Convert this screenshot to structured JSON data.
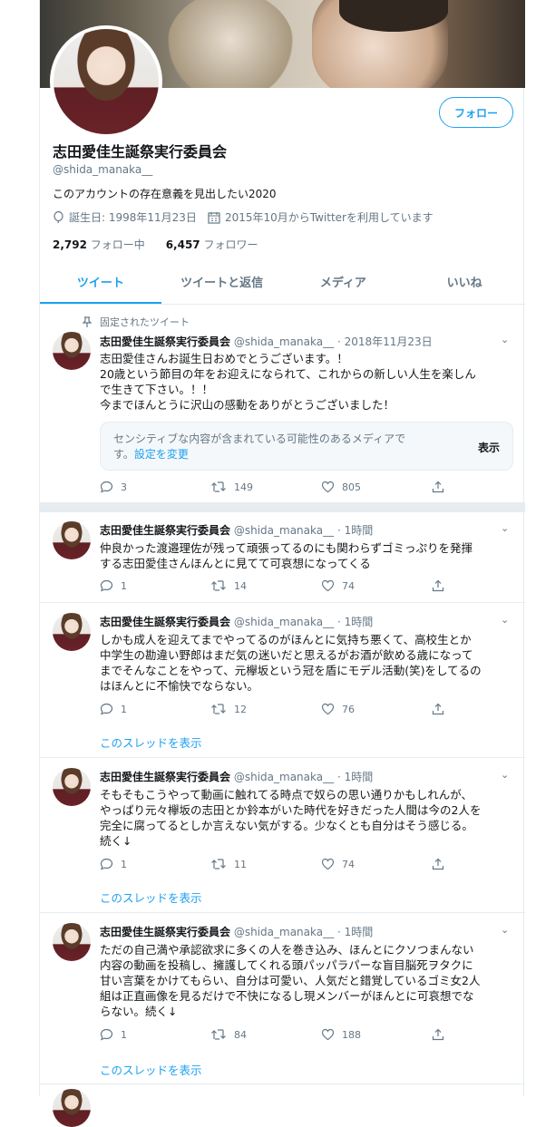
{
  "profile": {
    "display_name": "志田愛佳生誕祭実行委員会",
    "handle": "@shida_manaka__",
    "bio": "このアカウントの存在意義を見出したい2020",
    "birthday": "誕生日: 1998年11月23日",
    "joined": "2015年10月からTwitterを利用しています",
    "following_count": "2,792",
    "following_label": "フォロー中",
    "followers_count": "6,457",
    "followers_label": "フォロワー",
    "follow_button": "フォロー"
  },
  "tabs": [
    {
      "label": "ツイート",
      "active": true
    },
    {
      "label": "ツイートと返信"
    },
    {
      "label": "メディア"
    },
    {
      "label": "いいね"
    }
  ],
  "pinned_label": "固定されたツイート",
  "tweets": [
    {
      "name": "志田愛佳生誕祭実行委員会",
      "handle": "@shida_manaka__",
      "time": "· 2018年11月23日",
      "lines": [
        "志田愛佳さんお誕生日おめでとうございます。！",
        "20歳という節目の年をお迎えになられて、これからの新しい人生を楽しん",
        "で生きて下さい。！！",
        "今までほんとうに沢山の感動をありがとうございました！"
      ],
      "replies": "3",
      "retweets": "149",
      "likes": "805",
      "media_notice": "センシティブな内容が含まれている可能性のあるメディアで",
      "media_notice2": "す。",
      "media_settings": "設定を変更",
      "media_show": "表示"
    },
    {
      "name": "志田愛佳生誕祭実行委員会",
      "handle": "@shida_manaka__",
      "time": "· 1時間",
      "lines": [
        "仲良かった渡邉理佐が残って頑張ってるのにも関わらずゴミっぷりを発揮",
        "する志田愛佳さんほんとに見てて可哀想になってくる"
      ],
      "replies": "1",
      "retweets": "14",
      "likes": "74"
    },
    {
      "name": "志田愛佳生誕祭実行委員会",
      "handle": "@shida_manaka__",
      "time": "· 1時間",
      "lines": [
        "しかも成人を迎えてまでやってるのがほんとに気持ち悪くて、高校生とか",
        "中学生の勘違い野郎はまだ気の迷いだと思えるがお酒が飲める歳になって",
        "までそんなことをやって、元欅坂という冠を盾にモデル活動(笑)をしてるの",
        "はほんとに不愉快でならない。"
      ],
      "replies": "1",
      "retweets": "12",
      "likes": "76",
      "thread": "このスレッドを表示"
    },
    {
      "name": "志田愛佳生誕祭実行委員会",
      "handle": "@shida_manaka__",
      "time": "· 1時間",
      "lines": [
        "そもそもこうやって動画に触れてる時点で奴らの思い通りかもしれんが、",
        "やっぱり元々欅坂の志田とか鈴本がいた時代を好きだった人間は今の2人を",
        "完全に腐ってるとしか言えない気がする。少なくとも自分はそう感じる。",
        "続く↓"
      ],
      "replies": "1",
      "retweets": "11",
      "likes": "74",
      "thread": "このスレッドを表示"
    },
    {
      "name": "志田愛佳生誕祭実行委員会",
      "handle": "@shida_manaka__",
      "time": "· 1時間",
      "lines": [
        "ただの自己満や承認欲求に多くの人を巻き込み、ほんとにクソつまんない",
        "内容の動画を投稿し、擁護してくれる頭パッパラパーな盲目脳死ヲタクに",
        "甘い言葉をかけてもらい、自分は可愛い、人気だと錯覚しているゴミ女2人",
        "組は正直画像を見るだけで不快になるし現メンバーがほんとに可哀想でな",
        "らない。続く↓"
      ],
      "replies": "1",
      "retweets": "84",
      "likes": "188",
      "thread": "このスレッドを表示"
    }
  ],
  "colors": {
    "accent": "#1da1f2",
    "muted": "#657786",
    "border": "#e6ecf0"
  }
}
